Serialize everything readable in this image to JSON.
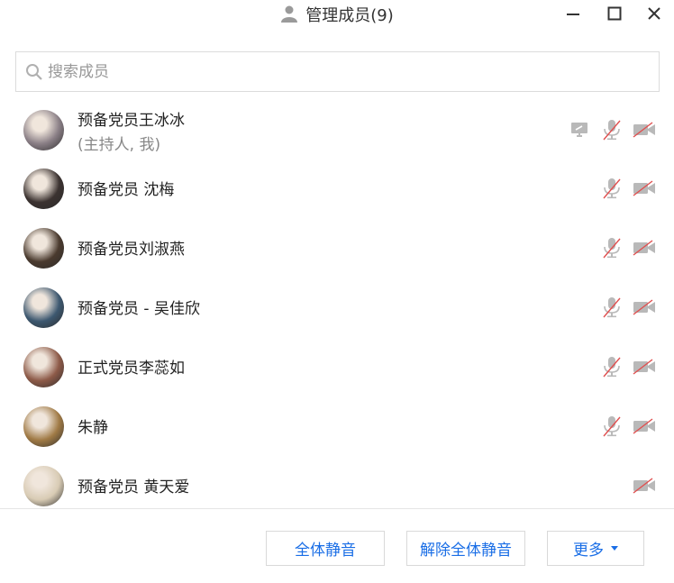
{
  "window": {
    "title": "管理成员(9)",
    "title_icon": "person-icon"
  },
  "search": {
    "placeholder": "搜索成员",
    "value": ""
  },
  "members": [
    {
      "name": "预备党员王冰冰",
      "sub": "(主持人, 我)",
      "avatar_color": "#8a7f86",
      "screen_share_icon": true,
      "mic_muted": true,
      "video_off": true
    },
    {
      "name": "预备党员 沈梅",
      "sub": "",
      "avatar_color": "#3b3230",
      "screen_share_icon": false,
      "mic_muted": true,
      "video_off": true
    },
    {
      "name": "预备党员刘淑燕",
      "sub": "",
      "avatar_color": "#4a3a2e",
      "screen_share_icon": false,
      "mic_muted": true,
      "video_off": true
    },
    {
      "name": "预备党员 - 吴佳欣",
      "sub": "",
      "avatar_color": "#3d5870",
      "screen_share_icon": false,
      "mic_muted": true,
      "video_off": true
    },
    {
      "name": "正式党员李蕊如",
      "sub": "",
      "avatar_color": "#8d5a48",
      "screen_share_icon": false,
      "mic_muted": true,
      "video_off": true
    },
    {
      "name": "朱静",
      "sub": "",
      "avatar_color": "#a07a45",
      "screen_share_icon": false,
      "mic_muted": true,
      "video_off": true
    },
    {
      "name": "预备党员 黄天爱",
      "sub": "",
      "avatar_color": "#d8cbb4",
      "screen_share_icon": false,
      "mic_muted": false,
      "video_off": true
    }
  ],
  "footer": {
    "mute_all": "全体静音",
    "unmute_all": "解除全体静音",
    "more": "更多"
  },
  "colors": {
    "accent": "#1a6ee6",
    "muted_slash": "#e05050",
    "icon_gray": "#b9b9b9"
  }
}
